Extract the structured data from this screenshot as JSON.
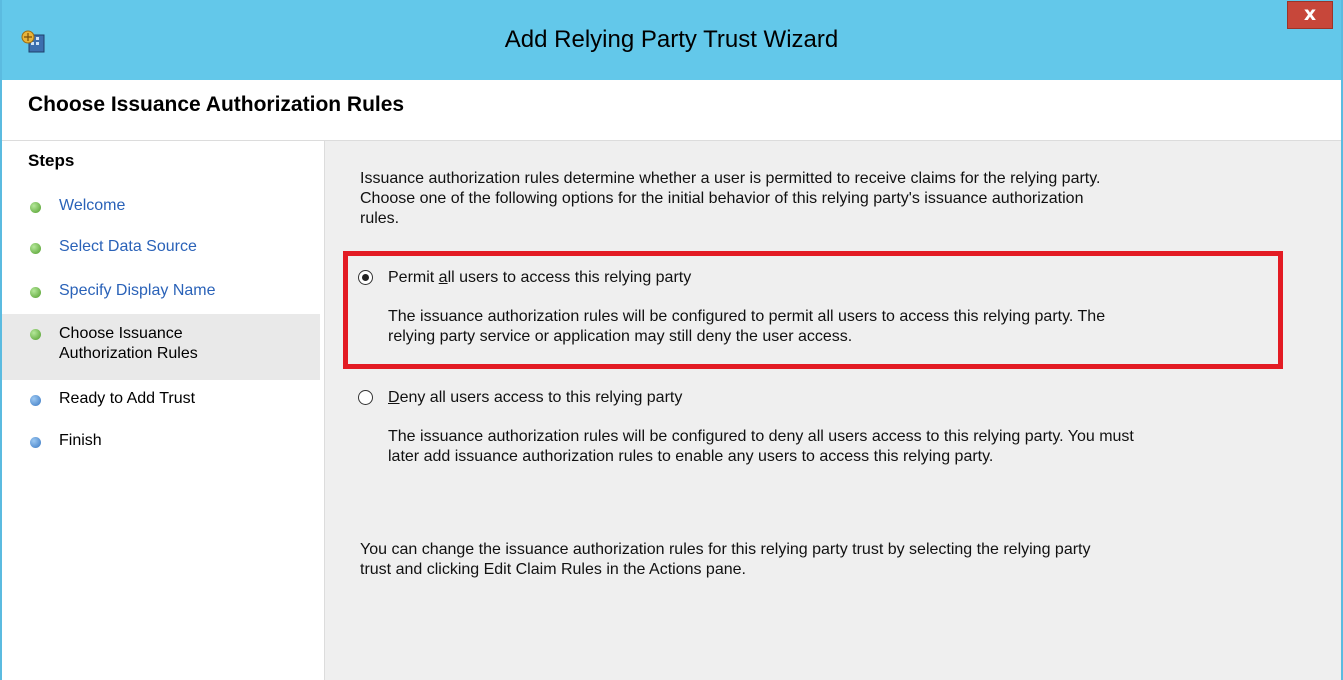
{
  "window": {
    "title": "Add Relying Party Trust Wizard",
    "close_label": "x",
    "accent_color": "#63c8ea",
    "close_color": "#c7473a"
  },
  "header": {
    "title": "Choose Issuance Authorization Rules"
  },
  "steps": {
    "title": "Steps",
    "items": [
      {
        "label": "Welcome",
        "status": "done",
        "link": true
      },
      {
        "label": "Select Data Source",
        "status": "done",
        "link": true
      },
      {
        "label": "Specify Display Name",
        "status": "done",
        "link": true
      },
      {
        "label_line1": "Choose Issuance",
        "label_line2": "Authorization Rules",
        "status": "current",
        "link": false
      },
      {
        "label": "Ready to Add Trust",
        "status": "todo",
        "link": false
      },
      {
        "label": "Finish",
        "status": "todo",
        "link": false
      }
    ]
  },
  "content": {
    "intro_line1": "Issuance authorization rules determine whether a user is permitted to receive claims for the relying party.",
    "intro_line2": "Choose one of the following options for the initial behavior of this relying party's issuance authorization",
    "intro_line3": "rules.",
    "options": [
      {
        "label_pre": "Permit ",
        "label_mnemonic": "a",
        "label_post": "ll users to access this relying party",
        "selected": true,
        "desc_line1": "The issuance authorization rules will be configured to permit all users to access this relying party. The",
        "desc_line2": "relying party service or application may still deny the user access."
      },
      {
        "label_pre": "",
        "label_mnemonic": "D",
        "label_post": "eny all users access to this relying party",
        "selected": false,
        "desc_line1": "The issuance authorization rules will be configured to deny all users access to this relying party. You must",
        "desc_line2": "later add issuance authorization rules to enable any users to access this relying party."
      }
    ],
    "footer_line1": "You can change the issuance authorization rules for this relying party trust by selecting the relying party",
    "footer_line2": "trust and clicking Edit Claim Rules in the Actions pane.",
    "highlight_color": "#e31b23"
  }
}
